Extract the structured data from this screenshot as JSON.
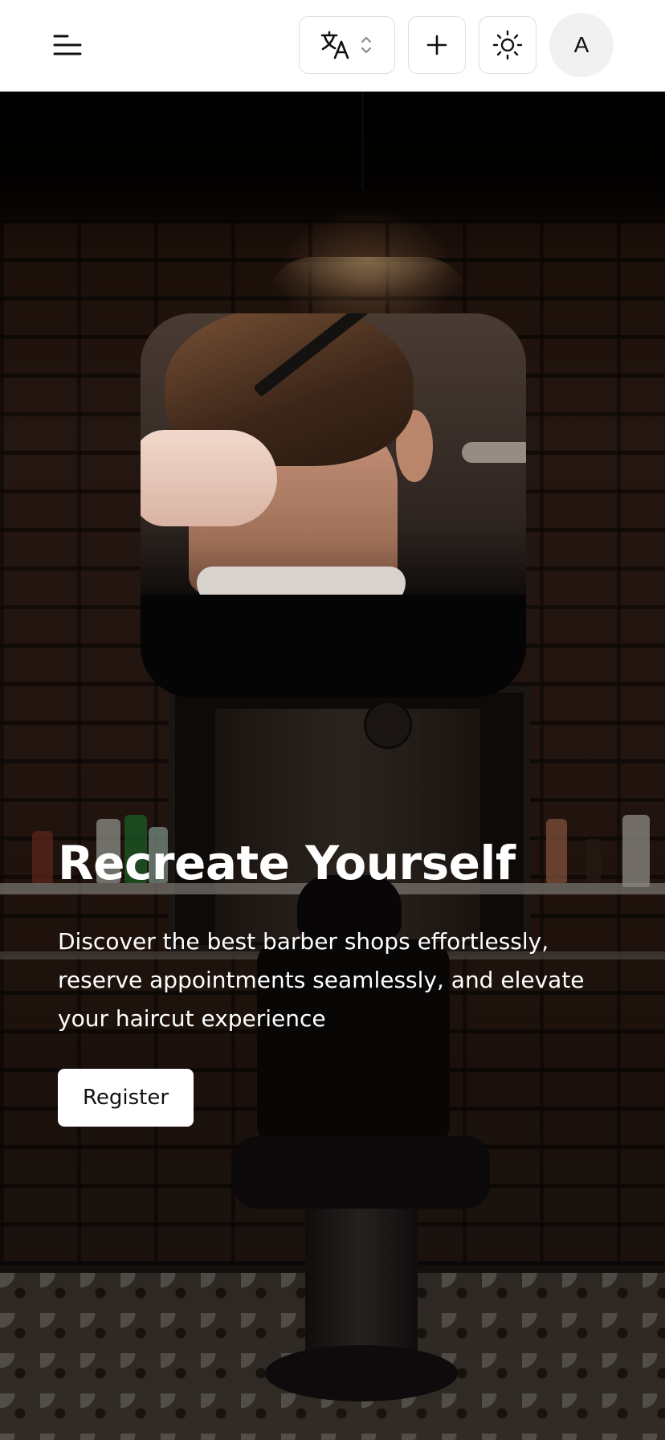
{
  "header": {
    "menu_icon": "menu-icon",
    "language_icon": "translate-icon",
    "language_chevron_icon": "chevron-up-down-icon",
    "add_icon": "plus-icon",
    "theme_icon": "sun-icon",
    "avatar_initial": "A"
  },
  "hero": {
    "title": "Recreate Yourself",
    "description": "Discover the best barber shops effortlessly, reserve appointments seamlessly, and elevate your haircut experience",
    "register_label": "Register",
    "featured_image": "barber-combing-hair-image",
    "background_image": "barbershop-interior-background"
  },
  "colors": {
    "header_bg": "#ffffff",
    "hero_text": "#ffffff",
    "button_bg": "#ffffff",
    "button_text": "#111111"
  }
}
